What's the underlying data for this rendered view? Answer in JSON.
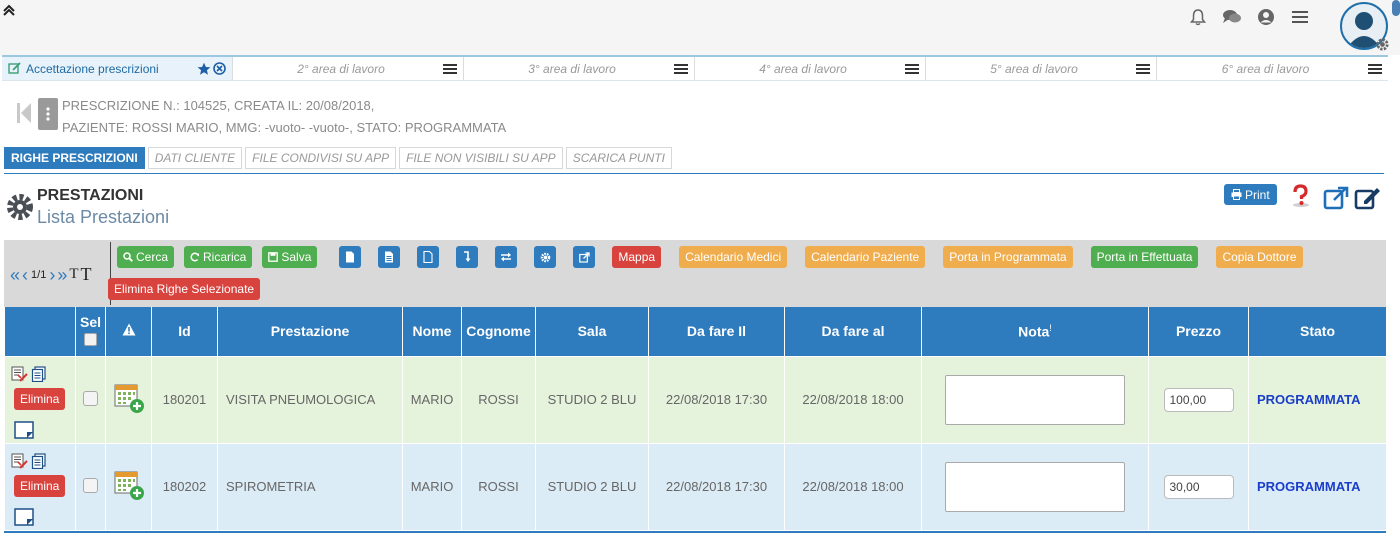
{
  "workspaces": [
    {
      "label": "Accettazione prescrizioni",
      "active": true
    },
    {
      "label": "2° area di lavoro"
    },
    {
      "label": "3° area di lavoro"
    },
    {
      "label": "4° area di lavoro"
    },
    {
      "label": "5° area di lavoro"
    },
    {
      "label": "6° area di lavoro"
    }
  ],
  "prescription": {
    "line1": "PRESCRIZIONE N.: 104525, CREATA IL: 20/08/2018,",
    "line2": "PAZIENTE: ROSSI MARIO, MMG: -vuoto- -vuoto-, STATO: PROGRAMMATA"
  },
  "subtabs": [
    "RIGHE PRESCRIZIONI",
    "DATI CLIENTE",
    "FILE CONDIVISI SU APP",
    "FILE NON VISIBILI SU APP",
    "SCARICA PUNTI"
  ],
  "section": {
    "title": "PRESTAZIONI",
    "subtitle": "Lista Prestazioni",
    "print_label": "Print"
  },
  "pager": {
    "count": "1/1",
    "font_small": "T",
    "font_big": "T"
  },
  "toolbar": {
    "cerca": "Cerca",
    "ricarica": "Ricarica",
    "salva": "Salva",
    "mappa": "Mappa",
    "calendario_medici": "Calendario Medici",
    "calendario_paziente": "Calendario Paziente",
    "porta_programmata": "Porta in Programmata",
    "porta_effettuata": "Porta in Effettuata",
    "copia_dottore": "Copia Dottore",
    "elimina_righe": "Elimina Righe Selezionate"
  },
  "table": {
    "headers": {
      "sel": "Sel",
      "id": "Id",
      "prestazione": "Prestazione",
      "nome": "Nome",
      "cognome": "Cognome",
      "sala": "Sala",
      "da_fare_il": "Da fare Il",
      "da_fare_al": "Da fare al",
      "nota": "Nota",
      "nota_sup": "!",
      "prezzo": "Prezzo",
      "stato": "Stato"
    },
    "elimina_label": "Elimina",
    "rows": [
      {
        "id": "180201",
        "prestazione": "VISITA PNEUMOLOGICA",
        "nome": "MARIO",
        "cognome": "ROSSI",
        "sala": "STUDIO 2 BLU",
        "da_fare_il": "22/08/2018 17:30",
        "da_fare_al": "22/08/2018 18:00",
        "prezzo": "100,00",
        "stato": "PROGRAMMATA"
      },
      {
        "id": "180202",
        "prestazione": "SPIROMETRIA",
        "nome": "MARIO",
        "cognome": "ROSSI",
        "sala": "STUDIO 2 BLU",
        "da_fare_il": "22/08/2018 17:30",
        "da_fare_al": "22/08/2018 18:00",
        "prezzo": "30,00",
        "stato": "PROGRAMMATA"
      }
    ]
  }
}
